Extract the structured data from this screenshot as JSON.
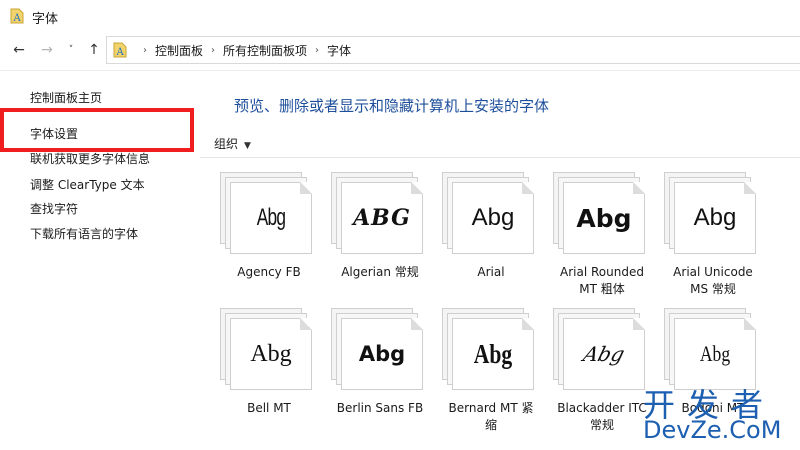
{
  "window": {
    "title": "字体"
  },
  "address": {
    "crumbs": [
      "控制面板",
      "所有控制面板项",
      "字体"
    ]
  },
  "sidebar": {
    "items": [
      {
        "label": "控制面板主页",
        "name": "sidebar-item-home"
      },
      {
        "label": "字体设置",
        "name": "sidebar-item-font-settings"
      },
      {
        "label": "联机获取更多字体信息",
        "name": "sidebar-item-online-info"
      },
      {
        "label": "调整 ClearType 文本",
        "name": "sidebar-item-cleartype"
      },
      {
        "label": "查找字符",
        "name": "sidebar-item-find-char"
      },
      {
        "label": "下载所有语言的字体",
        "name": "sidebar-item-download-fonts"
      }
    ]
  },
  "main": {
    "heading": "预览、删除或者显示和隐藏计算机上安装的字体",
    "organize_label": "组织"
  },
  "fonts": [
    {
      "sample": "Abg",
      "name_line1": "Agency FB",
      "name_line2": ""
    },
    {
      "sample": "ABG",
      "name_line1": "Algerian 常规",
      "name_line2": ""
    },
    {
      "sample": "Abg",
      "name_line1": "Arial",
      "name_line2": ""
    },
    {
      "sample": "Abg",
      "name_line1": "Arial Rounded",
      "name_line2": "MT 粗体"
    },
    {
      "sample": "Abg",
      "name_line1": "Arial Unicode",
      "name_line2": "MS 常规"
    },
    {
      "sample": "Abg",
      "name_line1": "Bell MT",
      "name_line2": ""
    },
    {
      "sample": "Abg",
      "name_line1": "Berlin Sans FB",
      "name_line2": ""
    },
    {
      "sample": "Abg",
      "name_line1": "Bernard MT 紧",
      "name_line2": "缩"
    },
    {
      "sample": "Abg",
      "name_line1": "Blackadder ITC",
      "name_line2": "常规"
    },
    {
      "sample": "Abg",
      "name_line1": "Bodoni MT",
      "name_line2": ""
    }
  ],
  "watermark": {
    "line1": "开发者",
    "line2": "DevZe.CoM"
  },
  "colors": {
    "heading": "#1e4f9b",
    "highlight": "#f01e1e",
    "watermark": "#1d5fb0"
  },
  "icons": {
    "back": "arrow-left-icon",
    "forward": "arrow-right-icon",
    "recent": "chevron-down-icon",
    "up": "arrow-up-icon"
  }
}
